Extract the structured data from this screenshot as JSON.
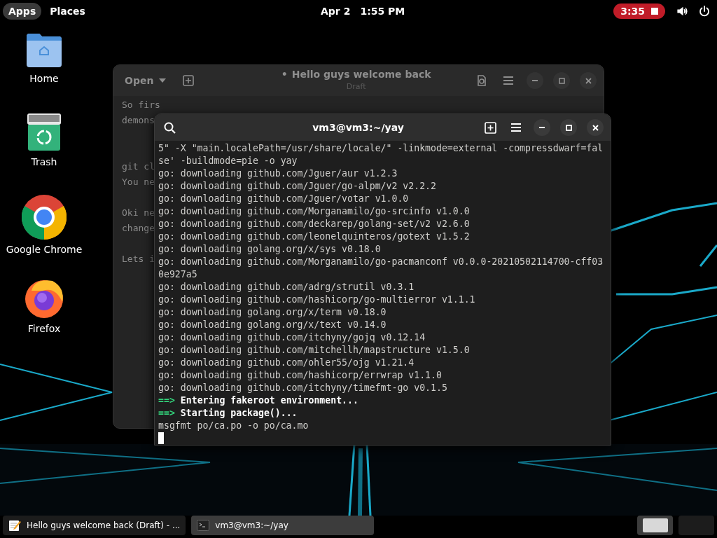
{
  "top_bar": {
    "apps": "Apps",
    "places": "Places",
    "date": "Apr 2",
    "time": "1:55 PM",
    "recording": "3:35"
  },
  "desktop_icons": [
    {
      "kind": "folder",
      "label": "Home"
    },
    {
      "kind": "trash",
      "label": "Trash"
    },
    {
      "kind": "chrome",
      "label": "Google Chrome"
    },
    {
      "kind": "firefox",
      "label": "Firefox"
    }
  ],
  "editor": {
    "open_button": "Open",
    "title": "Hello guys welcome back",
    "modified_mark": "•",
    "subtitle": "Draft",
    "lines": [
      {
        "kind": "text",
        "text": "So firs"
      },
      {
        "kind": "text",
        "text": "demons"
      },
      {
        "kind": "break"
      },
      {
        "kind": "break"
      },
      {
        "kind": "text",
        "text": "git cl"
      },
      {
        "kind": "text",
        "text": "You ne"
      },
      {
        "kind": "break"
      },
      {
        "kind": "text",
        "text": "Oki ne"
      },
      {
        "kind": "text",
        "text": "change"
      },
      {
        "kind": "break"
      },
      {
        "kind": "text",
        "text": "Lets i"
      }
    ]
  },
  "terminal": {
    "title": "vm3@vm3:~/yay",
    "lines": [
      {
        "kind": "plain",
        "text": "5\" -X \"main.localePath=/usr/share/locale/\" -linkmode=external -compressdwarf=fal"
      },
      {
        "kind": "plain",
        "text": "se' -buildmode=pie -o yay"
      },
      {
        "kind": "plain",
        "text": "go: downloading github.com/Jguer/aur v1.2.3"
      },
      {
        "kind": "plain",
        "text": "go: downloading github.com/Jguer/go-alpm/v2 v2.2.2"
      },
      {
        "kind": "plain",
        "text": "go: downloading github.com/Jguer/votar v1.0.0"
      },
      {
        "kind": "plain",
        "text": "go: downloading github.com/Morganamilo/go-srcinfo v1.0.0"
      },
      {
        "kind": "plain",
        "text": "go: downloading github.com/deckarep/golang-set/v2 v2.6.0"
      },
      {
        "kind": "plain",
        "text": "go: downloading github.com/leonelquinteros/gotext v1.5.2"
      },
      {
        "kind": "plain",
        "text": "go: downloading golang.org/x/sys v0.18.0"
      },
      {
        "kind": "plain",
        "text": "go: downloading github.com/Morganamilo/go-pacmanconf v0.0.0-20210502114700-cff03"
      },
      {
        "kind": "plain",
        "text": "0e927a5"
      },
      {
        "kind": "plain",
        "text": "go: downloading github.com/adrg/strutil v0.3.1"
      },
      {
        "kind": "plain",
        "text": "go: downloading github.com/hashicorp/go-multierror v1.1.1"
      },
      {
        "kind": "plain",
        "text": "go: downloading golang.org/x/term v0.18.0"
      },
      {
        "kind": "plain",
        "text": "go: downloading golang.org/x/text v0.14.0"
      },
      {
        "kind": "plain",
        "text": "go: downloading github.com/itchyny/gojq v0.12.14"
      },
      {
        "kind": "plain",
        "text": "go: downloading github.com/mitchellh/mapstructure v1.5.0"
      },
      {
        "kind": "plain",
        "text": "go: downloading github.com/ohler55/ojg v1.21.4"
      },
      {
        "kind": "plain",
        "text": "go: downloading github.com/hashicorp/errwrap v1.1.0"
      },
      {
        "kind": "plain",
        "text": "go: downloading github.com/itchyny/timefmt-go v0.1.5"
      },
      {
        "kind": "step",
        "arrow": "==>",
        "text": "Entering fakeroot environment..."
      },
      {
        "kind": "step",
        "arrow": "==>",
        "text": "Starting package()..."
      },
      {
        "kind": "plain",
        "text": "msgfmt po/ca.po -o po/ca.mo"
      },
      {
        "kind": "cursor"
      }
    ]
  },
  "taskbar": {
    "windows": [
      {
        "kind": "editor",
        "label": "Hello guys welcome back (Draft) - ...",
        "selected": false
      },
      {
        "kind": "terminal",
        "label": "vm3@vm3:~/yay",
        "selected": true
      }
    ],
    "workspaces": [
      {
        "selected": true
      },
      {
        "selected": false
      }
    ]
  }
}
